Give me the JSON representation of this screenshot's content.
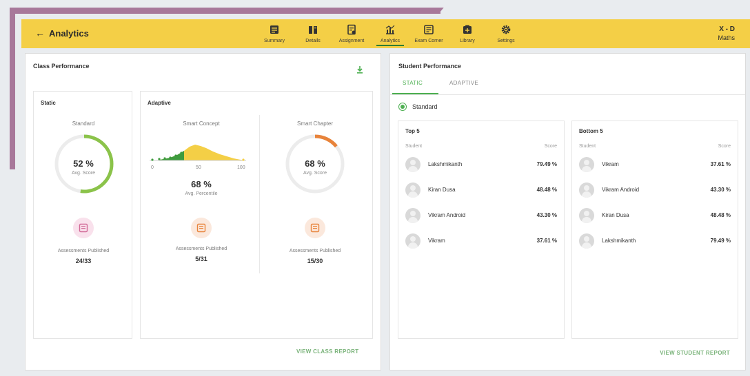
{
  "header": {
    "back_label": "Analytics",
    "nav": [
      {
        "label": "Summary",
        "icon": "summary-icon"
      },
      {
        "label": "Details",
        "icon": "details-icon"
      },
      {
        "label": "Assignment",
        "icon": "assignment-icon"
      },
      {
        "label": "Analytics",
        "icon": "analytics-icon",
        "active": true
      },
      {
        "label": "Exam Corner",
        "icon": "exam-corner-icon"
      },
      {
        "label": "Library",
        "icon": "library-icon"
      },
      {
        "label": "Settings",
        "icon": "settings-icon"
      }
    ],
    "class_name": "X - D",
    "subject": "Maths"
  },
  "class_performance": {
    "title": "Class Performance",
    "static": {
      "title": "Static",
      "gauge_label": "Standard",
      "value": "52 %",
      "value_pct": 52,
      "sub": "Avg. Score",
      "pub_label": "Assessments Published",
      "pub_value": "24/33"
    },
    "adaptive": {
      "title": "Adaptive",
      "concept": {
        "label": "Smart Concept",
        "axis": [
          "0",
          "50",
          "100"
        ],
        "value": "68 %",
        "sub": "Avg. Percentile",
        "pub_label": "Assessments Published",
        "pub_value": "5/31"
      },
      "chapter": {
        "label": "Smart Chapter",
        "value": "68 %",
        "value_pct": 68,
        "sub": "Avg. Score",
        "pub_label": "Assessments Published",
        "pub_value": "15/30"
      }
    },
    "link": "VIEW CLASS REPORT"
  },
  "student_performance": {
    "title": "Student Performance",
    "tabs": [
      "STATIC",
      "ADAPTIVE"
    ],
    "radio_label": "Standard",
    "top": {
      "title": "Top 5",
      "col_student": "Student",
      "col_score": "Score",
      "rows": [
        {
          "name": "Lakshmikanth",
          "score": "79.49 %"
        },
        {
          "name": "Kiran Dusa",
          "score": "48.48 %"
        },
        {
          "name": "Vikram Android",
          "score": "43.30 %"
        },
        {
          "name": "Vikram",
          "score": "37.61 %"
        }
      ]
    },
    "bottom": {
      "title": "Bottom 5",
      "col_student": "Student",
      "col_score": "Score",
      "rows": [
        {
          "name": "Vikram",
          "score": "37.61 %"
        },
        {
          "name": "Vikram Android",
          "score": "43.30 %"
        },
        {
          "name": "Kiran Dusa",
          "score": "48.48 %"
        },
        {
          "name": "Lakshmikanth",
          "score": "79.49 %"
        }
      ]
    },
    "link": "VIEW STUDENT REPORT"
  },
  "colors": {
    "header": "#f4cf46",
    "accent_green": "#4caf50",
    "gauge_green": "#8bc34a",
    "gauge_orange": "#e8833a",
    "decor": "#a8789a"
  }
}
